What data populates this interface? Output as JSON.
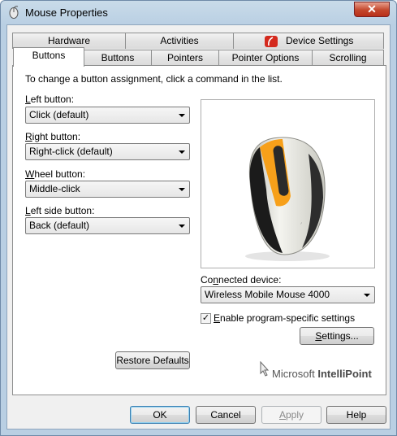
{
  "window": {
    "title": "Mouse Properties",
    "close_glyph": "✕"
  },
  "tabs": {
    "back_row": [
      {
        "label": "Hardware"
      },
      {
        "label": "Activities"
      },
      {
        "label": "Device Settings"
      }
    ],
    "front_row": [
      {
        "label": "Buttons"
      },
      {
        "label": "Buttons"
      },
      {
        "label": "Pointers"
      },
      {
        "label": "Pointer Options"
      },
      {
        "label": "Scrolling"
      }
    ]
  },
  "panel": {
    "instructions": "To change a button assignment, click a command in the list.",
    "left_button": {
      "label_u": "L",
      "label_rest": "eft button:",
      "value": "Click (default)"
    },
    "right_button": {
      "label_u": "R",
      "label_rest": "ight button:",
      "value": "Right-click (default)"
    },
    "wheel_button": {
      "label_u": "W",
      "label_rest": "heel button:",
      "value": "Middle-click"
    },
    "left_side_button": {
      "label_u": "L",
      "label_rest": "eft side button:",
      "value": "Back (default)"
    },
    "connected_device": {
      "label_pre": "Co",
      "label_u": "n",
      "label_post": "nected device:",
      "value": "Wireless Mobile Mouse 4000"
    },
    "enable_program_specific": {
      "label_u": "E",
      "label_rest": "nable program-specific settings",
      "checked": true
    },
    "settings_button": {
      "label_u": "S",
      "label_rest": "ettings..."
    },
    "restore_defaults_label": "Restore Defaults",
    "brand": {
      "prefix": "Microsoft",
      "product": "IntelliPoint"
    },
    "mouse_highlight_color": "#f7a01a"
  },
  "footer": {
    "ok": "OK",
    "cancel": "Cancel",
    "apply_u": "A",
    "apply_rest": "pply",
    "help": "Help"
  }
}
